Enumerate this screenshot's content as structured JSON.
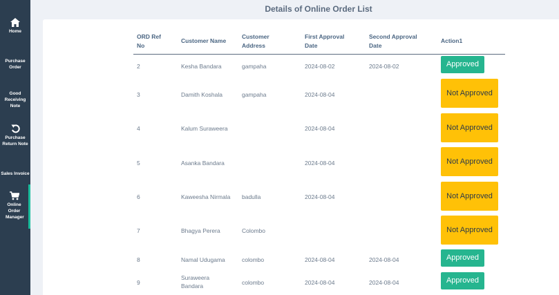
{
  "sidebar": {
    "items": [
      {
        "label": "Home",
        "icon": "home-icon"
      },
      {
        "label": "Purchase Order"
      },
      {
        "label": "Good Receiving Note"
      },
      {
        "label": "Purchase Return Note",
        "icon": "undo-icon"
      },
      {
        "label": "Sales Invoice"
      },
      {
        "label": "Online Order Manager",
        "icon": "cart-icon"
      }
    ]
  },
  "page": {
    "title": "Details of Online Order List"
  },
  "table": {
    "headers": {
      "ref": "ORD Ref No",
      "name": "Customer Name",
      "address": "Customer Address",
      "first": "First Approval Date",
      "second": "Second Approval Date",
      "action": "Action1"
    },
    "rows": [
      {
        "ref": "2",
        "name": "Kesha Bandara",
        "address": "gampaha",
        "first": "2024-08-02",
        "second": "2024-08-02",
        "action": "Approved"
      },
      {
        "ref": "3",
        "name": "Damith Koshala",
        "address": "gampaha",
        "first": "2024-08-04",
        "second": "",
        "action": "Not Approved"
      },
      {
        "ref": "4",
        "name": "Kalum Suraweera",
        "address": "",
        "first": "2024-08-04",
        "second": "",
        "action": "Not Approved"
      },
      {
        "ref": "5",
        "name": "Asanka Bandara",
        "address": "",
        "first": "2024-08-04",
        "second": "",
        "action": "Not Approved"
      },
      {
        "ref": "6",
        "name": "Kaweesha Nirmala",
        "address": "badulla",
        "first": "2024-08-04",
        "second": "",
        "action": "Not Approved"
      },
      {
        "ref": "7",
        "name": "Bhagya Perera",
        "address": "Colombo",
        "first": "",
        "second": "",
        "action": "Not Approved"
      },
      {
        "ref": "8",
        "name": "Namal Udugama",
        "address": "colombo",
        "first": "2024-08-04",
        "second": "2024-08-04",
        "action": "Approved"
      },
      {
        "ref": "9",
        "name": "Suraweera Bandara",
        "address": "colombo",
        "first": "2024-08-04",
        "second": "2024-08-04",
        "action": "Approved"
      }
    ]
  },
  "colors": {
    "sidebar": "#2c3e50",
    "approved": "#26b58f",
    "not_approved": "#ffc107",
    "active_indicator": "#1abc9c"
  }
}
